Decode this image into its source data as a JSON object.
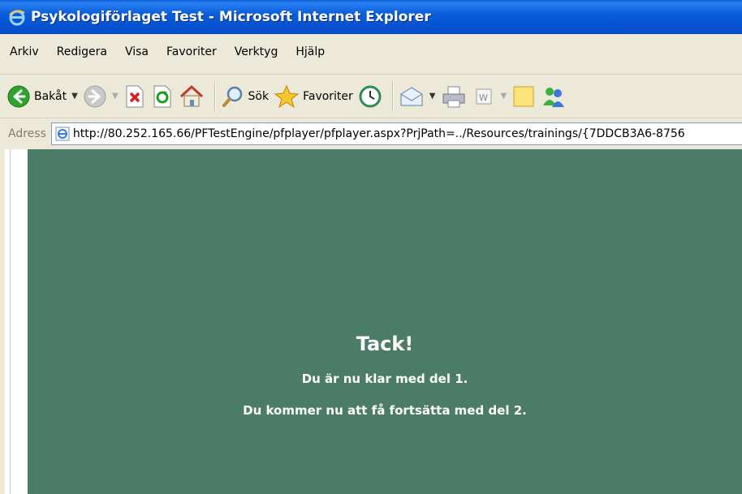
{
  "window": {
    "title": "Psykologiförlaget Test - Microsoft Internet Explorer"
  },
  "menu": [
    "Arkiv",
    "Redigera",
    "Visa",
    "Favoriter",
    "Verktyg",
    "Hjälp"
  ],
  "toolbar": {
    "back_label": "Bakåt",
    "search_label": "Sök",
    "favorites_label": "Favoriter"
  },
  "address": {
    "label": "Adress",
    "url": "http://80.252.165.66/PFTestEngine/pfplayer/pfplayer.aspx?PrjPath=../Resources/trainings/{7DDCB3A6-8756"
  },
  "page": {
    "title": "Tack!",
    "line1": "Du är nu klar med del 1.",
    "line2": "Du kommer nu att få fortsätta med del 2."
  },
  "colors": {
    "content_bg": "#4A7C68",
    "titlebar": "#0B5EDB",
    "chrome": "#ECE9D8"
  }
}
